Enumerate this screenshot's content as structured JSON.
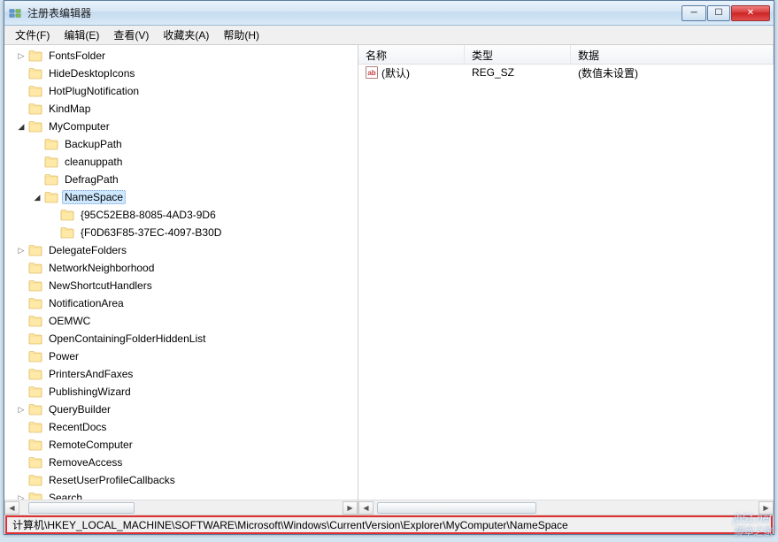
{
  "window": {
    "title": "注册表编辑器"
  },
  "menu": {
    "file": "文件(F)",
    "edit": "编辑(E)",
    "view": "查看(V)",
    "favorites": "收藏夹(A)",
    "help": "帮助(H)"
  },
  "tree": {
    "items": [
      {
        "level": 8,
        "exp": "▷",
        "label": "FontsFolder"
      },
      {
        "level": 8,
        "exp": "",
        "label": "HideDesktopIcons"
      },
      {
        "level": 8,
        "exp": "",
        "label": "HotPlugNotification"
      },
      {
        "level": 8,
        "exp": "",
        "label": "KindMap"
      },
      {
        "level": 8,
        "exp": "◢",
        "label": "MyComputer"
      },
      {
        "level": 9,
        "exp": "",
        "label": "BackupPath"
      },
      {
        "level": 9,
        "exp": "",
        "label": "cleanuppath"
      },
      {
        "level": 9,
        "exp": "",
        "label": "DefragPath"
      },
      {
        "level": 9,
        "exp": "◢",
        "label": "NameSpace",
        "sel": true
      },
      {
        "level": 10,
        "exp": "",
        "label": "{95C52EB8-8085-4AD3-9D6"
      },
      {
        "level": 10,
        "exp": "",
        "label": "{F0D63F85-37EC-4097-B30D"
      },
      {
        "level": 8,
        "exp": "▷",
        "label": "DelegateFolders"
      },
      {
        "level": 8,
        "exp": "",
        "label": "NetworkNeighborhood"
      },
      {
        "level": 8,
        "exp": "",
        "label": "NewShortcutHandlers"
      },
      {
        "level": 8,
        "exp": "",
        "label": "NotificationArea"
      },
      {
        "level": 8,
        "exp": "",
        "label": "OEMWC"
      },
      {
        "level": 8,
        "exp": "",
        "label": "OpenContainingFolderHiddenList"
      },
      {
        "level": 8,
        "exp": "",
        "label": "Power"
      },
      {
        "level": 8,
        "exp": "",
        "label": "PrintersAndFaxes"
      },
      {
        "level": 8,
        "exp": "",
        "label": "PublishingWizard"
      },
      {
        "level": 8,
        "exp": "▷",
        "label": "QueryBuilder"
      },
      {
        "level": 8,
        "exp": "",
        "label": "RecentDocs"
      },
      {
        "level": 8,
        "exp": "",
        "label": "RemoteComputer"
      },
      {
        "level": 8,
        "exp": "",
        "label": "RemoveAccess"
      },
      {
        "level": 8,
        "exp": "",
        "label": "ResetUserProfileCallbacks"
      },
      {
        "level": 8,
        "exp": "▷",
        "label": "Search"
      }
    ]
  },
  "list": {
    "columns": {
      "name": "名称",
      "type": "类型",
      "data": "数据"
    },
    "rows": [
      {
        "name": "(默认)",
        "type": "REG_SZ",
        "data": "(数值未设置)"
      }
    ]
  },
  "status": {
    "path": "计算机\\HKEY_LOCAL_MACHINE\\SOFTWARE\\Microsoft\\Windows\\CurrentVersion\\Explorer\\MyComputer\\NameSpace"
  },
  "watermark": {
    "url": "jb51.net",
    "cn": "脚本之家"
  }
}
